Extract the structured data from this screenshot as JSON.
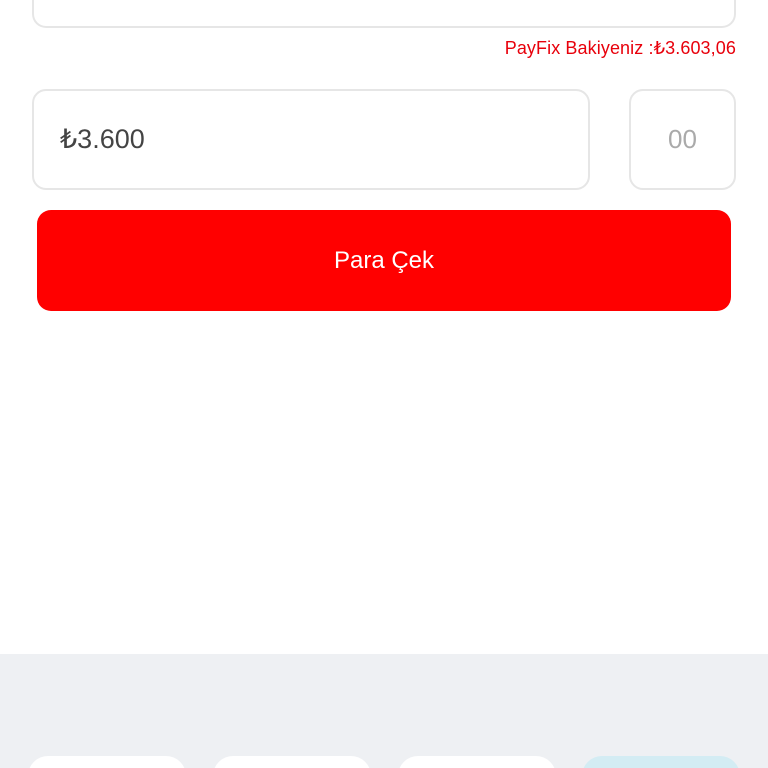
{
  "balance": {
    "label": "PayFix Bakiyeniz :₺3.603,06"
  },
  "amount": {
    "value": "₺3.600"
  },
  "cents": {
    "placeholder": "00"
  },
  "actions": {
    "withdraw_label": "Para Çek"
  },
  "colors": {
    "accent": "#ff0000",
    "balance_text": "#e8000b",
    "bottom_panel": "#eef0f3"
  }
}
